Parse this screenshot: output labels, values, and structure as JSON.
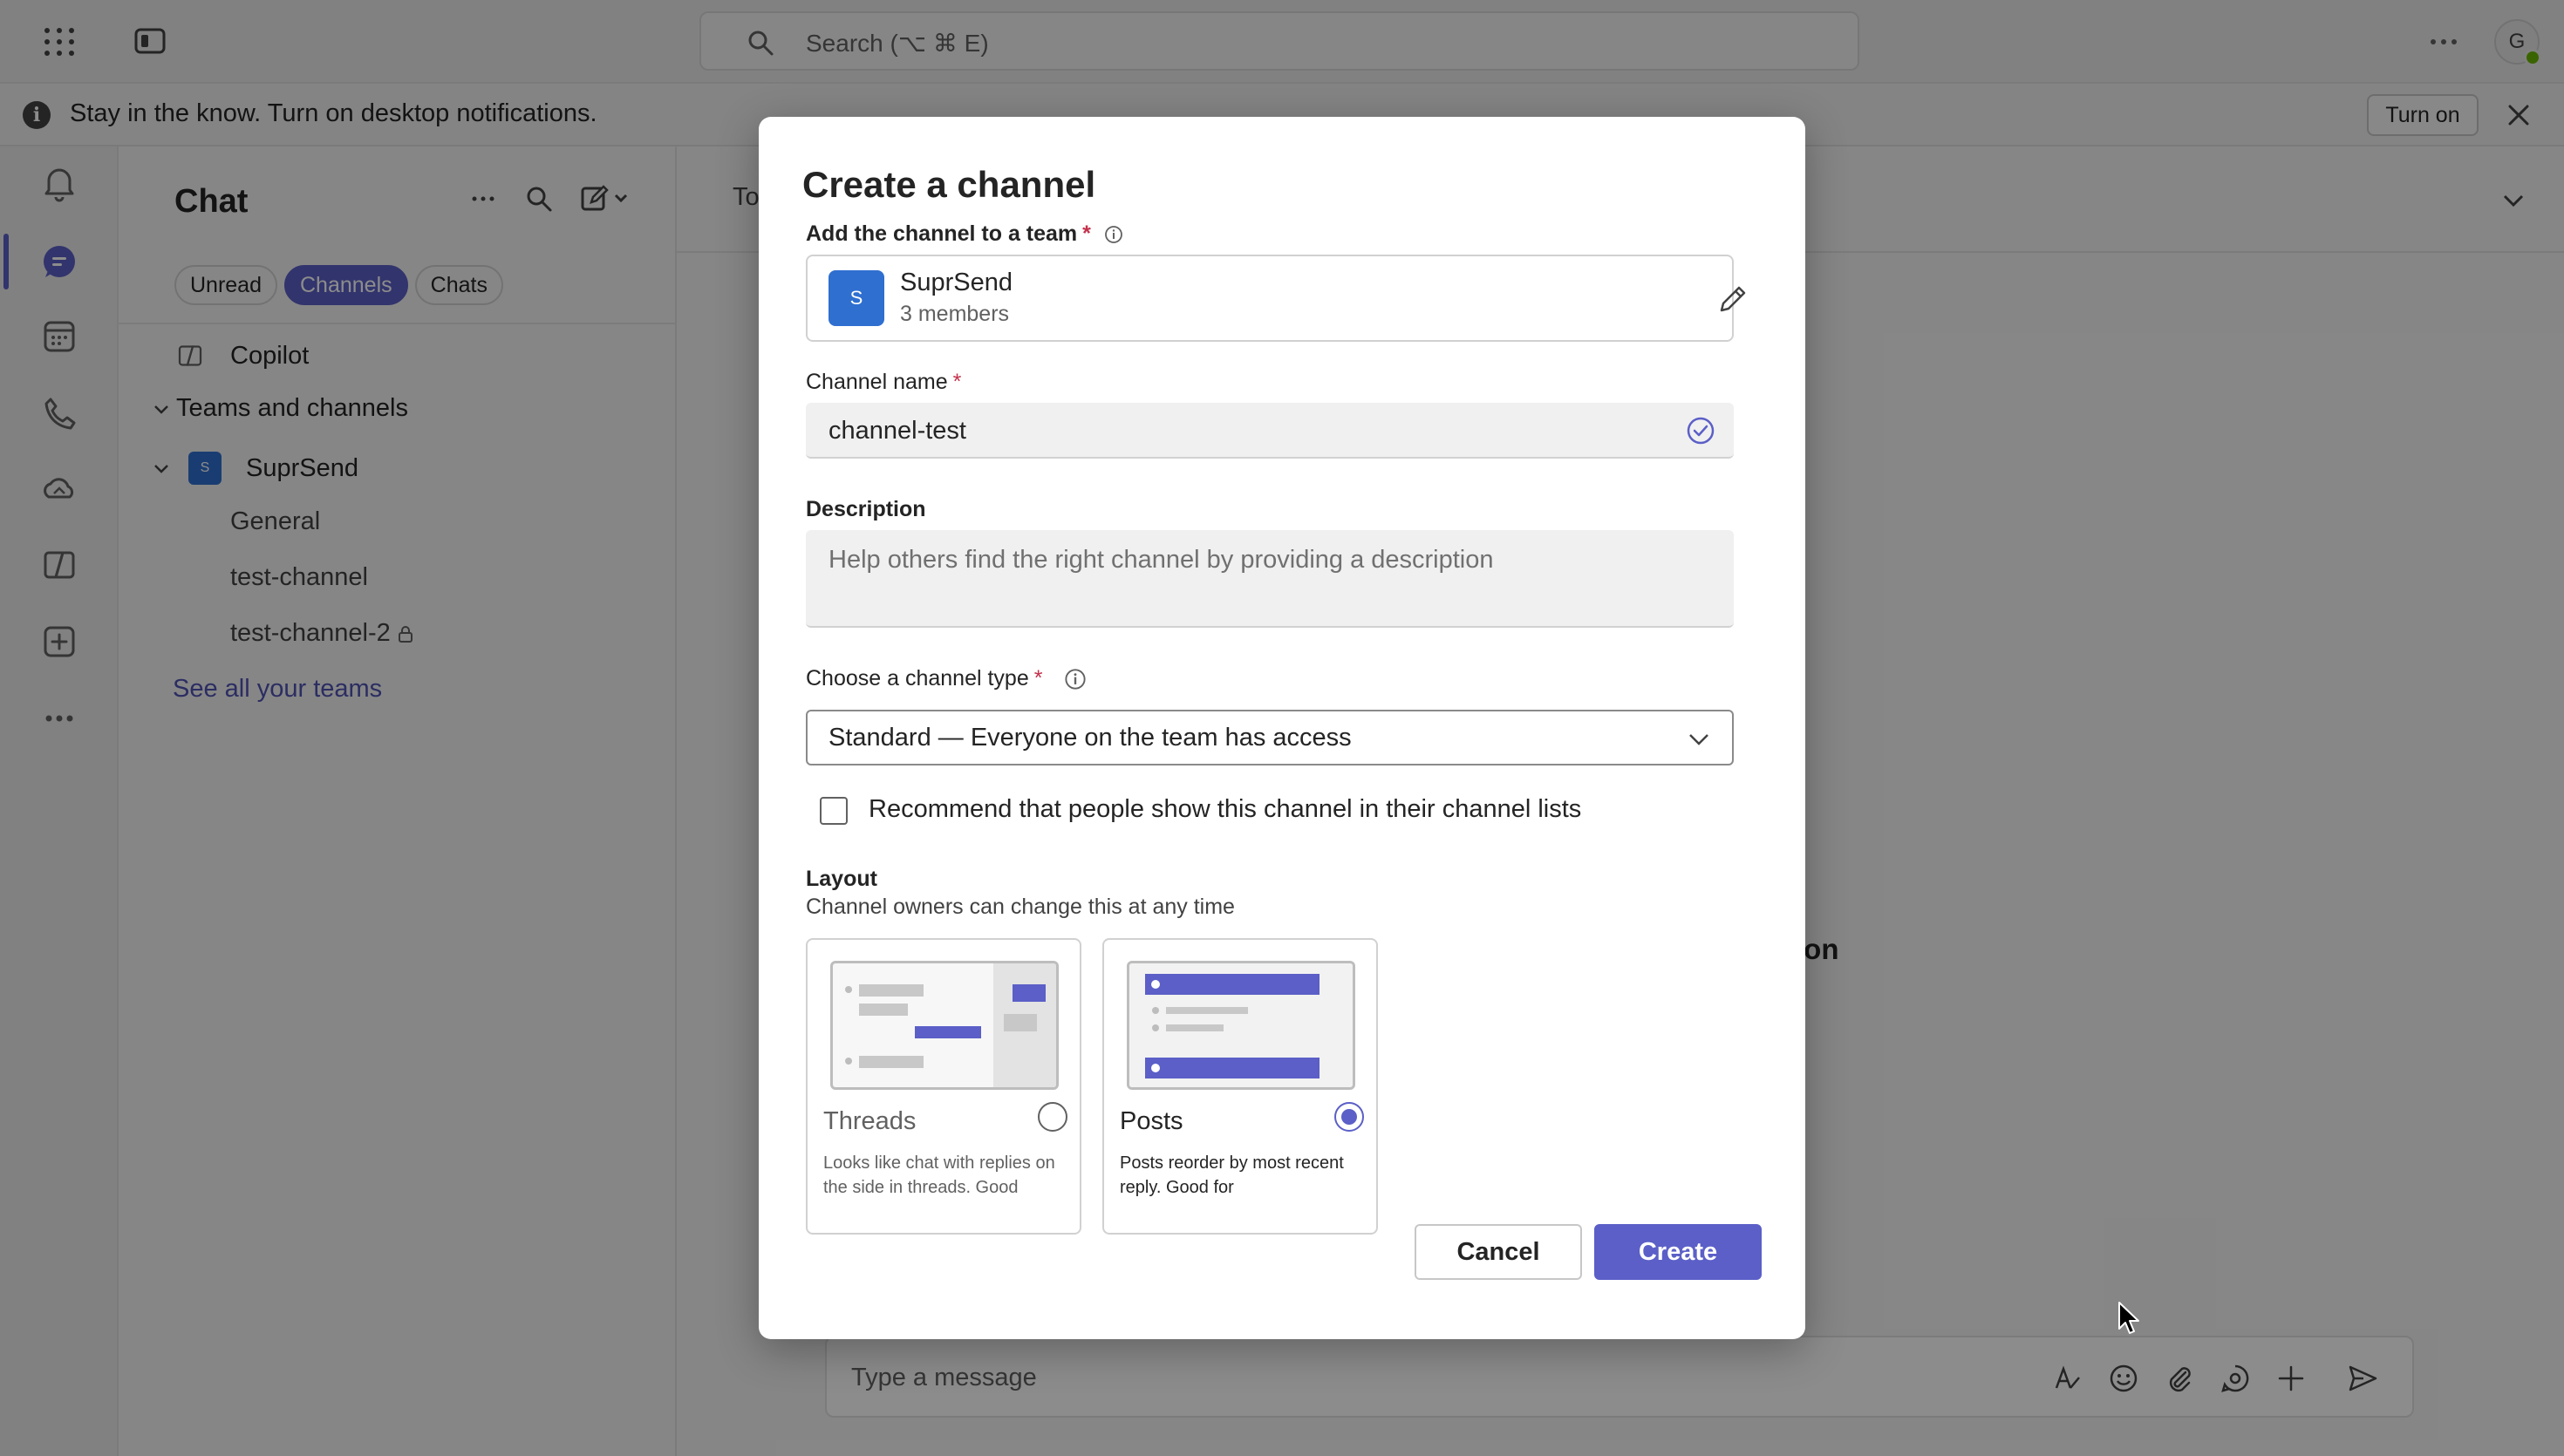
{
  "titlebar": {
    "search_placeholder": "Search (⌥ ⌘ E)",
    "avatar_initial": "G"
  },
  "notification": {
    "message": "Stay in the know. Turn on desktop notifications.",
    "turn_on_label": "Turn on"
  },
  "chat_pane": {
    "title": "Chat",
    "filters": [
      "Unread",
      "Channels",
      "Chats"
    ],
    "active_filter": "Channels",
    "copilot_label": "Copilot",
    "teams_section_label": "Teams and channels",
    "team": {
      "name": "SuprSend",
      "tile_letter": "S"
    },
    "channels": [
      "General",
      "test-channel",
      "test-channel-2"
    ],
    "see_all_label": "See all your teams"
  },
  "main": {
    "to_label": "To",
    "background_fragment": "tion",
    "composer_placeholder": "Type a message"
  },
  "dialog": {
    "title": "Create a channel",
    "team_field_label": "Add the channel to a team",
    "team_name": "SuprSend",
    "team_members": "3 members",
    "team_tile_letter": "S",
    "name_label": "Channel name",
    "name_value": "channel-test",
    "description_label": "Description",
    "description_placeholder": "Help others find the right channel by providing a description",
    "type_label": "Choose a channel type",
    "type_value": "Standard — Everyone on the team has access",
    "recommend_label": "Recommend that people show this channel in their channel lists",
    "recommend_checked": false,
    "layout_title": "Layout",
    "layout_subtitle": "Channel owners can change this at any time",
    "layouts": [
      {
        "name": "Threads",
        "description": "Looks like chat with replies on the side in threads. Good",
        "selected": false
      },
      {
        "name": "Posts",
        "description": "Posts reorder by most recent reply. Good for",
        "selected": true
      }
    ],
    "cancel_label": "Cancel",
    "create_label": "Create"
  },
  "colors": {
    "brand": "#5b5fc7",
    "team_tile": "#2f6fd0",
    "required": "#c4314b",
    "presence": "#6bb700"
  },
  "icons": {
    "titlebar": [
      "app-launcher-icon",
      "sidebar-toggle-icon",
      "search-icon",
      "more-icon"
    ],
    "rail": [
      "activity-icon",
      "chat-icon",
      "calendar-icon",
      "calls-icon",
      "onedrive-icon",
      "copilot-icon",
      "apps-icon",
      "more-apps-icon"
    ],
    "composer": [
      "format-icon",
      "emoji-icon",
      "attach-icon",
      "loop-icon",
      "add-icon",
      "send-icon"
    ]
  }
}
